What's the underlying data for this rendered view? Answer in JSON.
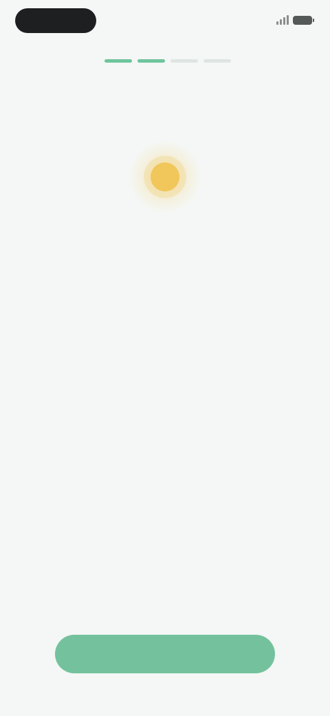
{
  "status_bar": {
    "time": "",
    "signal_icon": "signal-icon",
    "battery_icon": "battery-icon"
  },
  "progress": {
    "total_steps": 4,
    "current_step": 2
  },
  "hero": {
    "icon": "sun-icon",
    "icon_color": "#f1c65a"
  },
  "items": [
    {
      "label": ""
    },
    {
      "label": ""
    },
    {
      "label": ""
    },
    {
      "label": ""
    },
    {
      "label": ""
    },
    {
      "label": ""
    }
  ],
  "footer": {
    "secondary_label": "",
    "primary_label": ""
  },
  "colors": {
    "background": "#f4f7f5",
    "accent": "#74c29d"
  }
}
